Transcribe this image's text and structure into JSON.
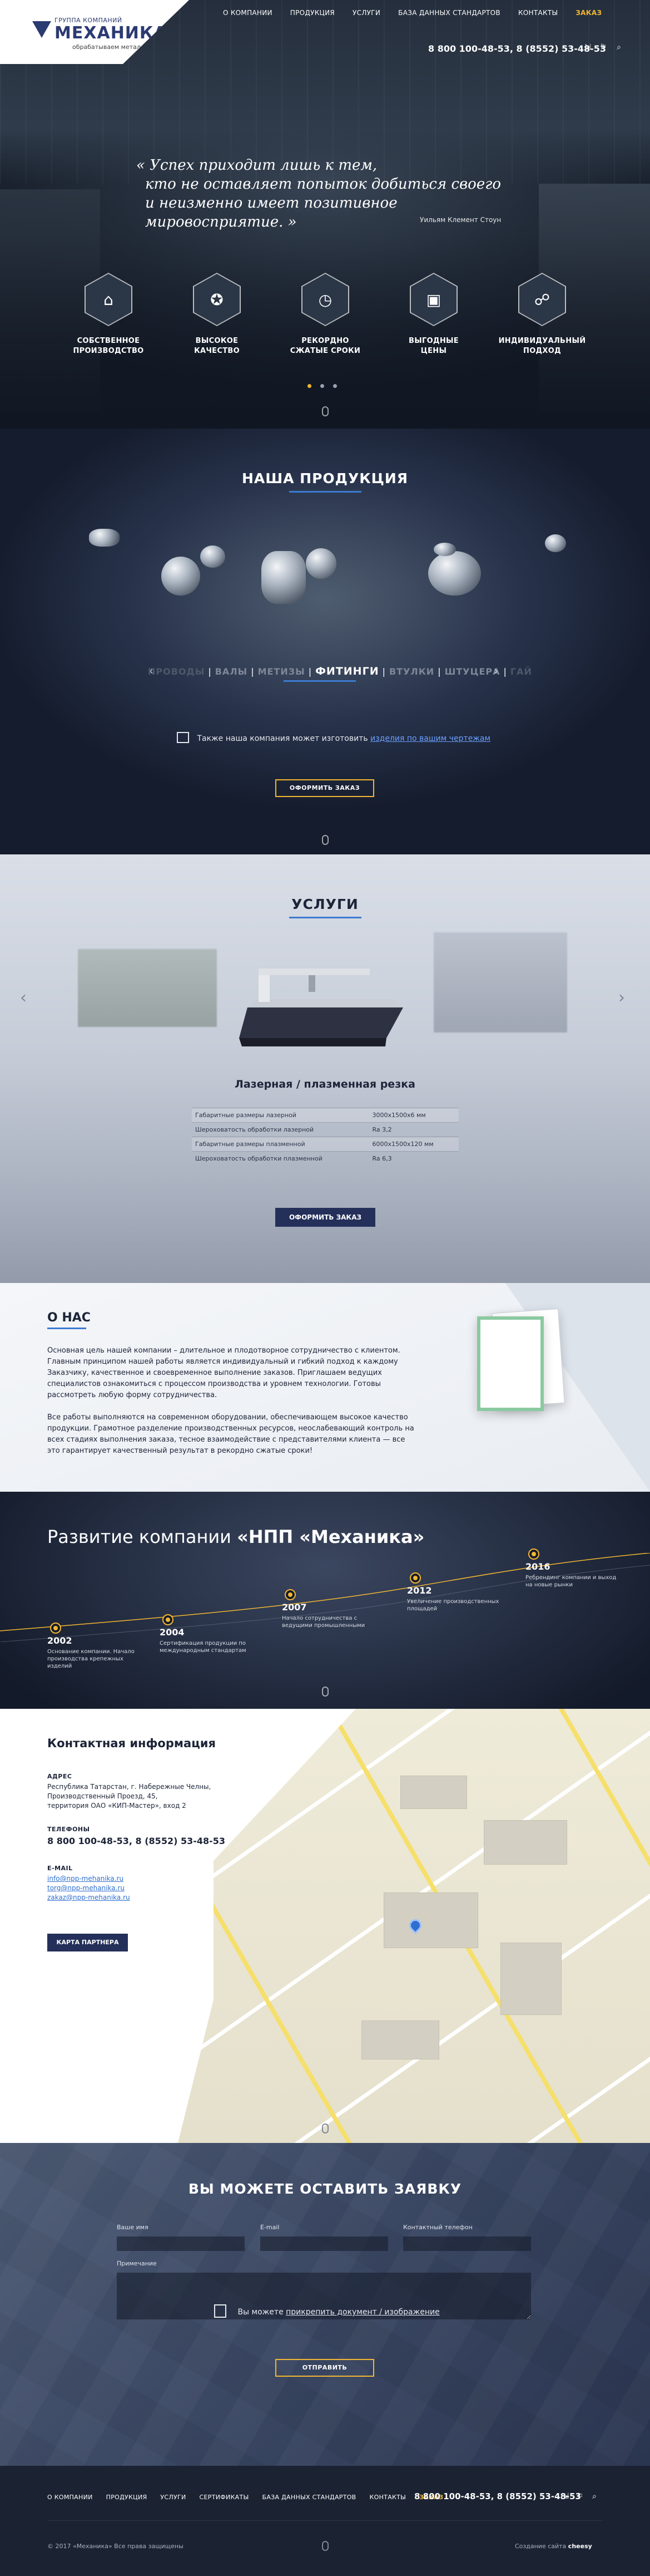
{
  "header": {
    "logo_top": "ГРУППА КОМПАНИЙ",
    "logo_name": "МЕХАНИКА",
    "logo_sub": "обрабатываем металл",
    "nav": [
      "О КОМПАНИИ",
      "ПРОДУКЦИЯ",
      "УСЛУГИ",
      "БАЗА ДАННЫХ СТАНДАРТОВ",
      "КОНТАКТЫ",
      "ЗАКАЗ"
    ],
    "phones": "8 800 100-48-53, 8 (8552) 53-48-53",
    "icons": [
      "login-icon",
      "language-icon",
      "search-icon"
    ]
  },
  "hero": {
    "quote_line1": "« Успех приходит лишь к тем,",
    "quote_line2": "кто не оставляет попыток добиться своего",
    "quote_line3": "и неизменно имеет позитивное мировосприятие. »",
    "quote_author": "Уильям Клемент Стоун",
    "features": [
      {
        "line1": "СОБСТВЕННОЕ",
        "line2": "ПРОИЗВОДСТВО",
        "icon": "factory-icon"
      },
      {
        "line1": "ВЫСОКОЕ",
        "line2": "КАЧЕСТВО",
        "icon": "quality-badge-icon"
      },
      {
        "line1": "РЕКОРДНО",
        "line2": "СЖАТЫЕ СРОКИ",
        "icon": "stopwatch-icon"
      },
      {
        "line1": "ВЫГОДНЫЕ",
        "line2": "ЦЕНЫ",
        "icon": "wallet-icon"
      },
      {
        "line1": "ИНДИВИДУАЛЬНЫЙ",
        "line2": "ПОДХОД",
        "icon": "handshake-icon"
      }
    ],
    "slide_active": 1,
    "slides_total": 3
  },
  "products": {
    "title": "НАША ПРОДУКЦИЯ",
    "categories": [
      "ПРОВОДЫ",
      "ВАЛЫ",
      "МЕТИЗЫ",
      "ФИТИНГИ",
      "ВТУЛКИ",
      "ШТУЦЕРА",
      "ГАЙ"
    ],
    "active_category": "ФИТИНГИ",
    "drawing_text": "Также наша компания может изготовить",
    "drawing_link": "изделия по вашим чертежам",
    "order_button": "ОФОРМИТЬ ЗАКАЗ"
  },
  "services": {
    "title": "УСЛУГИ",
    "name": "Лазерная / плазменная резка",
    "specs": [
      {
        "label": "Габаритные размеры лазерной",
        "value": "3000x1500x6 мм"
      },
      {
        "label": "Шероховатость обработки лазерной",
        "value": "Ra 3,2"
      },
      {
        "label": "Габаритные размеры плазменной",
        "value": "6000x1500x120 мм"
      },
      {
        "label": "Шероховатость обработки плазменной",
        "value": "Ra 6,3"
      }
    ],
    "order_button": "ОФОРМИТЬ ЗАКАЗ"
  },
  "about": {
    "title": "О НАС",
    "p1": "Основная цель нашей компании – длительное и плодотворное сотрудничество с клиентом. Главным принципом нашей работы является индивидуальный и гибкий подход к каждому Заказчику, качественное и своевременное выполнение заказов. Приглашаем ведущих специалистов ознакомиться с процессом производства и уровнем технологии. Готовы рассмотреть любую форму сотрудничества.",
    "p2": "Все работы выполняются на современном оборудовании, обеспечивающем высокое качество продукции. Грамотное разделение производственных ресурсов, неослабевающий контроль на всех стадиях выполнения заказа, тесное взаимодействие с представителями клиента — все это гарантирует качественный результат в рекордно сжатые сроки!"
  },
  "history": {
    "title_plain": "Развитие компании",
    "title_bold": "«НПП «Механика»",
    "milestones": [
      {
        "year": "2002",
        "text": "Основание компании. Начало производства крепежных изделий"
      },
      {
        "year": "2004",
        "text": "Сертификация продукции по международным стандартам"
      },
      {
        "year": "2007",
        "text": "Начало сотрудничества с ведущими промышленными"
      },
      {
        "year": "2012",
        "text": "Увеличение производственных площадей"
      },
      {
        "year": "2016",
        "text": "Ребрендинг компании и выход на новые рынки"
      }
    ]
  },
  "contacts": {
    "title": "Контактная информация",
    "address_label": "АДРЕС",
    "address_line1": "Республика Татарстан, г. Набережные Челны,",
    "address_line2": "Производственный Проезд, 45,",
    "address_line3": "территория ОАО «КИП-Мастер», вход 2",
    "phone_label": "ТЕЛЕФОНЫ",
    "phones": "8 800 100-48-53, 8 (8552) 53-48-53",
    "email_label": "E-MAIL",
    "emails": [
      "info@npp-mehanika.ru",
      "torg@npp-mehanika.ru",
      "zakaz@npp-mehanika.ru"
    ],
    "partner_button": "КАРТА ПАРТНЕРА"
  },
  "request": {
    "title": "ВЫ МОЖЕТЕ ОСТАВИТЬ ЗАЯВКУ",
    "name_label": "Ваше имя",
    "email_label": "E-mail",
    "phone_label": "Контактный телефон",
    "note_label": "Примечание",
    "attach_text": "Вы можете",
    "attach_link": "прикрепить документ / изображение",
    "send_button": "ОТПРАВИТЬ"
  },
  "footer": {
    "nav": [
      "О КОМПАНИИ",
      "ПРОДУКЦИЯ",
      "УСЛУГИ",
      "СЕРТИФИКАТЫ",
      "БАЗА ДАННЫХ СТАНДАРТОВ",
      "КОНТАКТЫ",
      "ЗАКАЗ"
    ],
    "phones": "8 800 100-48-53, 8 (8552) 53-48-53",
    "copyright": "© 2017 «Механика» Все права защищены",
    "made_by": "Создание сайта",
    "made_by_name": "cheesy"
  }
}
